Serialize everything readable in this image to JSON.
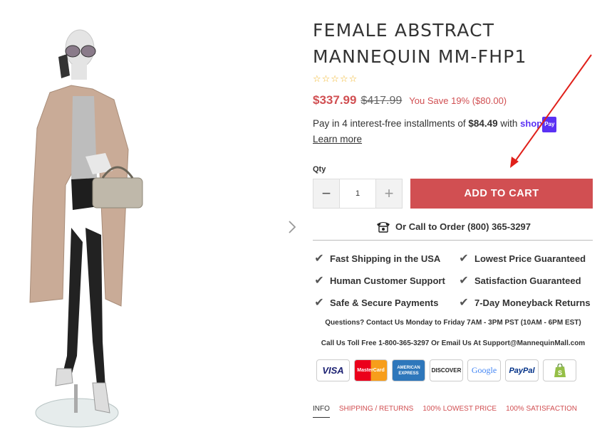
{
  "product": {
    "title_line1": "FEMALE ABSTRACT",
    "title_line2": "MANNEQUIN MM-FHP1",
    "stars": "☆☆☆☆☆",
    "rating": 0,
    "price_sale": "$337.99",
    "price_old": "$417.99",
    "you_save": "You Save 19% ($80.00)"
  },
  "installments": {
    "prefix": "Pay in 4 interest-free installments of ",
    "amount": "$84.49",
    "suffix": " with ",
    "shop_logo": "shop",
    "pay_badge": "Pay",
    "learn_more": "Learn more"
  },
  "cart": {
    "qty_label": "Qty",
    "qty_value": "1",
    "minus": "−",
    "plus": "+",
    "add_to_cart": "ADD TO CART"
  },
  "call": {
    "icon": "telephone-icon",
    "text": "Or Call to Order (800) 365-3297"
  },
  "features": [
    "Fast Shipping in the USA",
    "Lowest Price Guaranteed",
    "Human Customer Support",
    "Satisfaction Guaranteed",
    "Safe & Secure Payments",
    "7-Day Moneyback Returns"
  ],
  "support": {
    "questions": "Questions? Contact Us Monday to Friday 7AM - 3PM PST (10AM - 6PM EST)",
    "contact": "Call Us Toll Free 1-800-365-3297 Or Email Us At Support@MannequinMall.com"
  },
  "payment_icons": [
    {
      "name": "visa-icon",
      "label": "VISA",
      "color": "#1a1f71"
    },
    {
      "name": "mastercard-icon",
      "label": "MasterCard",
      "color": "#eb001b"
    },
    {
      "name": "amex-icon",
      "label": "AMERICAN EXPRESS",
      "color": "#2e77bb"
    },
    {
      "name": "discover-icon",
      "label": "DISCOVER",
      "color": "#f58220"
    },
    {
      "name": "google-icon",
      "label": "Google",
      "color": "#4285f4"
    },
    {
      "name": "paypal-icon",
      "label": "PayPal",
      "color": "#003087"
    },
    {
      "name": "shopify-icon",
      "label": "",
      "color": "#95bf47"
    }
  ],
  "tabs": [
    "INFO",
    "SHIPPING / RETURNS",
    "100% LOWEST PRICE",
    "100% SATISFACTION"
  ],
  "colors": {
    "accent": "#d14f52",
    "shop_pay": "#5a31f4",
    "star": "#f0b429",
    "annotation_arrow": "#e0201a"
  }
}
